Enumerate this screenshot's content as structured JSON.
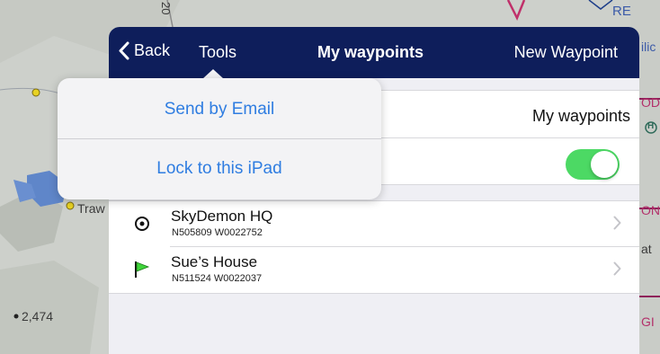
{
  "map": {
    "labels": {
      "top_number": "20",
      "top_right_fragment": "RE",
      "right_fragment_1": "ilic",
      "right_fragment_2": "OD",
      "right_fragment_3": "ON",
      "right_fragment_4": "at",
      "right_fragment_5": "GI",
      "traw": "Traw",
      "elevation": "2,474",
      "heli_symbol": "H"
    }
  },
  "navbar": {
    "back_label": "Back",
    "tools_label": "Tools",
    "title": "My waypoints",
    "new_waypoint_label": "New Waypoint"
  },
  "settings": {
    "list_name_value": "My waypoints",
    "toggle_on": true
  },
  "popover": {
    "items": [
      {
        "label": "Send by Email"
      },
      {
        "label": "Lock to this iPad"
      }
    ]
  },
  "waypoints": [
    {
      "name": "SkyDemon HQ",
      "coords": "N505809 W0022752",
      "icon": "target-icon"
    },
    {
      "name": "Sue’s House",
      "coords": "N511524 W0022037",
      "icon": "green-flag-icon"
    }
  ],
  "colors": {
    "navbar_bg": "#0e1e5b",
    "toggle_on": "#4cd964",
    "popover_text": "#2f7de1",
    "flag_green": "#3fd43a"
  }
}
